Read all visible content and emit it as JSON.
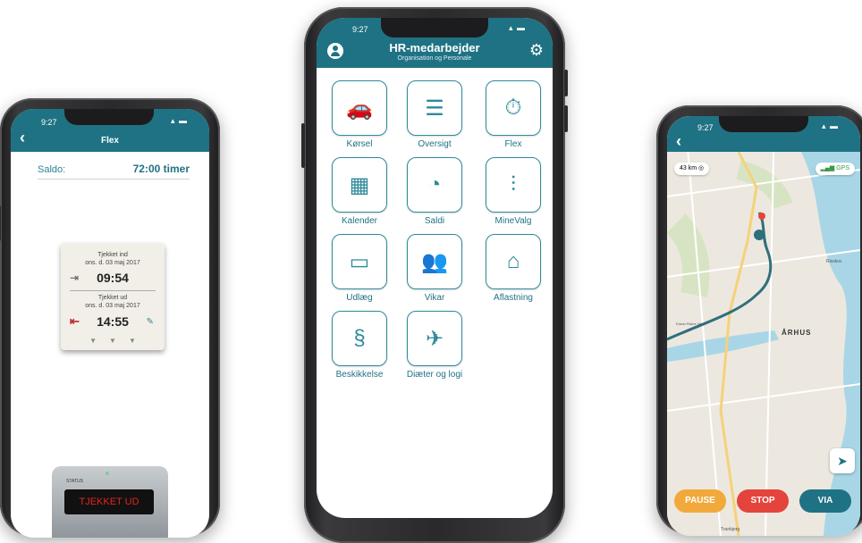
{
  "flex_phone": {
    "time": "9:27",
    "title": "Flex",
    "saldo_label": "Saldo:",
    "saldo_value": "72:00 timer",
    "checkin_label": "Tjekket ind",
    "checkin_date": "ons. d. 03 maj 2017",
    "checkin_time": "09:54",
    "checkout_label": "Tjekket ud",
    "checkout_date": "ons. d. 03 maj 2017",
    "checkout_time": "14:55",
    "device_status_label": "STATUS",
    "device_display": "TJEKKET UD"
  },
  "menu_phone": {
    "time": "9:27",
    "title": "HR-medarbejder",
    "subtitle": "Organisation og Personale",
    "tiles": [
      {
        "label": "Kørsel",
        "icon": "car-icon",
        "glyph": "🚗"
      },
      {
        "label": "Oversigt",
        "icon": "list-icon",
        "glyph": "☰"
      },
      {
        "label": "Flex",
        "icon": "stopwatch-icon",
        "glyph": "⏱"
      },
      {
        "label": "Kalender",
        "icon": "calendar-icon",
        "glyph": "▦"
      },
      {
        "label": "Saldi",
        "icon": "clock-sum-icon",
        "glyph": "◔"
      },
      {
        "label": "MineValg",
        "icon": "sliders-icon",
        "glyph": "⫶"
      },
      {
        "label": "Udlæg",
        "icon": "wallet-icon",
        "glyph": "▭"
      },
      {
        "label": "Vikar",
        "icon": "substitute-icon",
        "glyph": "👥"
      },
      {
        "label": "Aflastning",
        "icon": "house-people-icon",
        "glyph": "⌂"
      },
      {
        "label": "Beskikkelse",
        "icon": "appointment-icon",
        "glyph": "§"
      },
      {
        "label": "Diæter og logi",
        "icon": "travel-globe-icon",
        "glyph": "✈"
      }
    ]
  },
  "map_phone": {
    "time": "9:27",
    "distance": "43 km",
    "gps_label": "GPS",
    "city": "ÅRHUS",
    "places": [
      "Risskov",
      "Edwin Rahrs Vej",
      "Tranbjerg"
    ],
    "pause_label": "PAUSE",
    "stop_label": "STOP",
    "via_label": "VIA",
    "colors": {
      "pause": "#f2a93b",
      "stop": "#e5443d",
      "via": "#1f7283",
      "route": "#2f6f7c"
    }
  }
}
